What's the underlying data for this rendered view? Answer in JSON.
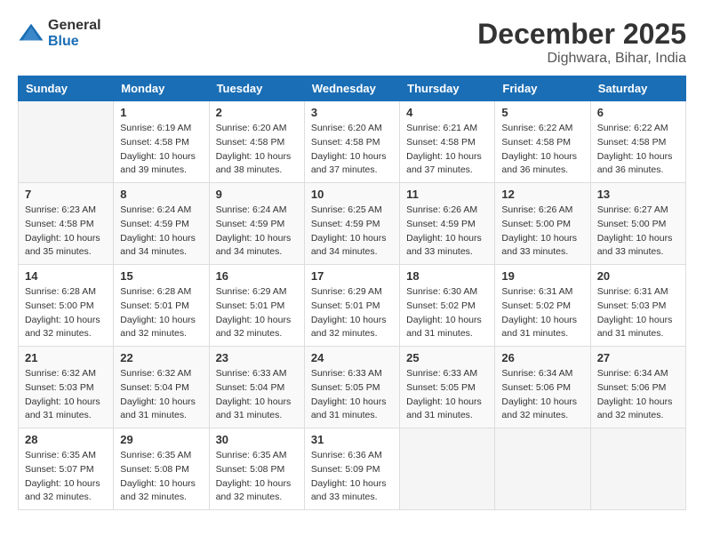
{
  "logo": {
    "general": "General",
    "blue": "Blue"
  },
  "header": {
    "month": "December 2025",
    "location": "Dighwara, Bihar, India"
  },
  "weekdays": [
    "Sunday",
    "Monday",
    "Tuesday",
    "Wednesday",
    "Thursday",
    "Friday",
    "Saturday"
  ],
  "weeks": [
    [
      {
        "day": "",
        "info": ""
      },
      {
        "day": "1",
        "info": "Sunrise: 6:19 AM\nSunset: 4:58 PM\nDaylight: 10 hours\nand 39 minutes."
      },
      {
        "day": "2",
        "info": "Sunrise: 6:20 AM\nSunset: 4:58 PM\nDaylight: 10 hours\nand 38 minutes."
      },
      {
        "day": "3",
        "info": "Sunrise: 6:20 AM\nSunset: 4:58 PM\nDaylight: 10 hours\nand 37 minutes."
      },
      {
        "day": "4",
        "info": "Sunrise: 6:21 AM\nSunset: 4:58 PM\nDaylight: 10 hours\nand 37 minutes."
      },
      {
        "day": "5",
        "info": "Sunrise: 6:22 AM\nSunset: 4:58 PM\nDaylight: 10 hours\nand 36 minutes."
      },
      {
        "day": "6",
        "info": "Sunrise: 6:22 AM\nSunset: 4:58 PM\nDaylight: 10 hours\nand 36 minutes."
      }
    ],
    [
      {
        "day": "7",
        "info": "Sunrise: 6:23 AM\nSunset: 4:58 PM\nDaylight: 10 hours\nand 35 minutes."
      },
      {
        "day": "8",
        "info": "Sunrise: 6:24 AM\nSunset: 4:59 PM\nDaylight: 10 hours\nand 34 minutes."
      },
      {
        "day": "9",
        "info": "Sunrise: 6:24 AM\nSunset: 4:59 PM\nDaylight: 10 hours\nand 34 minutes."
      },
      {
        "day": "10",
        "info": "Sunrise: 6:25 AM\nSunset: 4:59 PM\nDaylight: 10 hours\nand 34 minutes."
      },
      {
        "day": "11",
        "info": "Sunrise: 6:26 AM\nSunset: 4:59 PM\nDaylight: 10 hours\nand 33 minutes."
      },
      {
        "day": "12",
        "info": "Sunrise: 6:26 AM\nSunset: 5:00 PM\nDaylight: 10 hours\nand 33 minutes."
      },
      {
        "day": "13",
        "info": "Sunrise: 6:27 AM\nSunset: 5:00 PM\nDaylight: 10 hours\nand 33 minutes."
      }
    ],
    [
      {
        "day": "14",
        "info": "Sunrise: 6:28 AM\nSunset: 5:00 PM\nDaylight: 10 hours\nand 32 minutes."
      },
      {
        "day": "15",
        "info": "Sunrise: 6:28 AM\nSunset: 5:01 PM\nDaylight: 10 hours\nand 32 minutes."
      },
      {
        "day": "16",
        "info": "Sunrise: 6:29 AM\nSunset: 5:01 PM\nDaylight: 10 hours\nand 32 minutes."
      },
      {
        "day": "17",
        "info": "Sunrise: 6:29 AM\nSunset: 5:01 PM\nDaylight: 10 hours\nand 32 minutes."
      },
      {
        "day": "18",
        "info": "Sunrise: 6:30 AM\nSunset: 5:02 PM\nDaylight: 10 hours\nand 31 minutes."
      },
      {
        "day": "19",
        "info": "Sunrise: 6:31 AM\nSunset: 5:02 PM\nDaylight: 10 hours\nand 31 minutes."
      },
      {
        "day": "20",
        "info": "Sunrise: 6:31 AM\nSunset: 5:03 PM\nDaylight: 10 hours\nand 31 minutes."
      }
    ],
    [
      {
        "day": "21",
        "info": "Sunrise: 6:32 AM\nSunset: 5:03 PM\nDaylight: 10 hours\nand 31 minutes."
      },
      {
        "day": "22",
        "info": "Sunrise: 6:32 AM\nSunset: 5:04 PM\nDaylight: 10 hours\nand 31 minutes."
      },
      {
        "day": "23",
        "info": "Sunrise: 6:33 AM\nSunset: 5:04 PM\nDaylight: 10 hours\nand 31 minutes."
      },
      {
        "day": "24",
        "info": "Sunrise: 6:33 AM\nSunset: 5:05 PM\nDaylight: 10 hours\nand 31 minutes."
      },
      {
        "day": "25",
        "info": "Sunrise: 6:33 AM\nSunset: 5:05 PM\nDaylight: 10 hours\nand 31 minutes."
      },
      {
        "day": "26",
        "info": "Sunrise: 6:34 AM\nSunset: 5:06 PM\nDaylight: 10 hours\nand 32 minutes."
      },
      {
        "day": "27",
        "info": "Sunrise: 6:34 AM\nSunset: 5:06 PM\nDaylight: 10 hours\nand 32 minutes."
      }
    ],
    [
      {
        "day": "28",
        "info": "Sunrise: 6:35 AM\nSunset: 5:07 PM\nDaylight: 10 hours\nand 32 minutes."
      },
      {
        "day": "29",
        "info": "Sunrise: 6:35 AM\nSunset: 5:08 PM\nDaylight: 10 hours\nand 32 minutes."
      },
      {
        "day": "30",
        "info": "Sunrise: 6:35 AM\nSunset: 5:08 PM\nDaylight: 10 hours\nand 32 minutes."
      },
      {
        "day": "31",
        "info": "Sunrise: 6:36 AM\nSunset: 5:09 PM\nDaylight: 10 hours\nand 33 minutes."
      },
      {
        "day": "",
        "info": ""
      },
      {
        "day": "",
        "info": ""
      },
      {
        "day": "",
        "info": ""
      }
    ]
  ]
}
